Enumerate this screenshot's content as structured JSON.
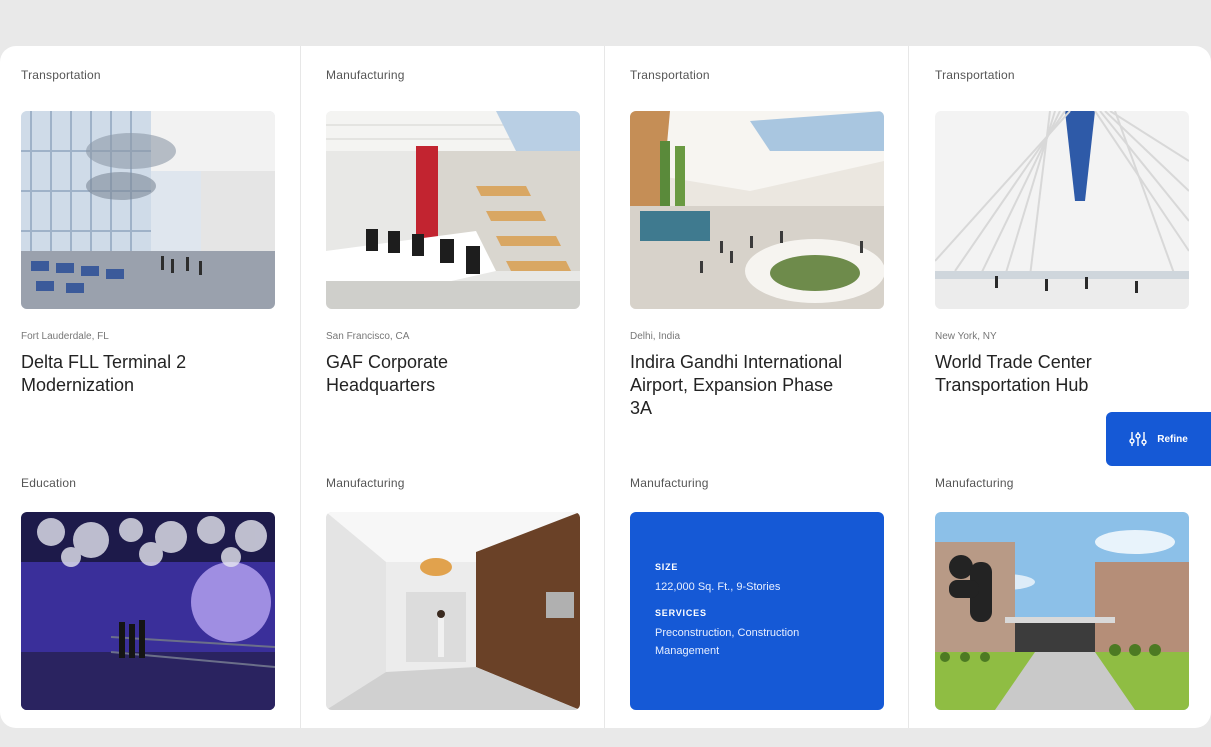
{
  "refine": {
    "label": "Refine",
    "icon": "sliders-icon",
    "color": "#1559d6"
  },
  "row1": [
    {
      "category": "Transportation",
      "location": "Fort Lauderdale, FL",
      "title": "Delta FLL Terminal 2 Modernization"
    },
    {
      "category": "Manufacturing",
      "location": "San Francisco, CA",
      "title": "GAF Corporate Headquarters"
    },
    {
      "category": "Transportation",
      "location": "Delhi, India",
      "title": "Indira Gandhi International Airport, Expansion Phase 3A"
    },
    {
      "category": "Transportation",
      "location": "New York, NY",
      "title": "World Trade Center Transportation Hub"
    }
  ],
  "row2": [
    {
      "category": "Education"
    },
    {
      "category": "Manufacturing"
    },
    {
      "category": "Manufacturing",
      "info": {
        "size_label": "SIZE",
        "size_value": "122,000 Sq. Ft., 9-Stories",
        "services_label": "SERVICES",
        "services_value": "Preconstruction, Construction Management"
      }
    },
    {
      "category": "Manufacturing"
    }
  ]
}
